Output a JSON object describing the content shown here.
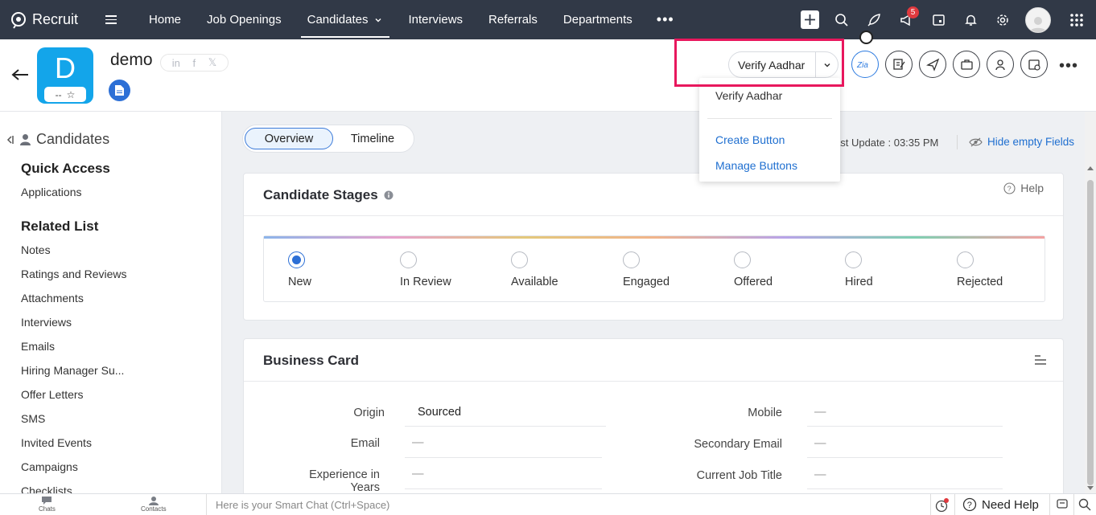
{
  "app": {
    "name": "Recruit"
  },
  "nav": {
    "items": [
      "Home",
      "Job Openings",
      "Candidates",
      "Interviews",
      "Referrals",
      "Departments"
    ],
    "active": "Candidates",
    "more": "•••",
    "notification_count": "5"
  },
  "candidate": {
    "initial": "D",
    "name": "demo",
    "rating": "--",
    "social": [
      "in",
      "f",
      "𝕏"
    ]
  },
  "actions": {
    "verify_label": "Verify Aadhar",
    "more": "•••"
  },
  "dropdown": {
    "items": [
      "Verify Aadhar",
      "Create Button",
      "Manage Buttons"
    ]
  },
  "sidebar": {
    "title": "Candidates",
    "quick_access_title": "Quick Access",
    "quick_access_items": [
      "Applications"
    ],
    "related_title": "Related List",
    "related_items": [
      "Notes",
      "Ratings and Reviews",
      "Attachments",
      "Interviews",
      "Emails",
      "Hiring Manager Su...",
      "Offer Letters",
      "SMS",
      "Invited Events",
      "Campaigns",
      "Checklists"
    ]
  },
  "tabs": {
    "overview": "Overview",
    "timeline": "Timeline"
  },
  "last_update": "ast Update : 03:35 PM",
  "hide_empty": "Hide empty Fields",
  "stages": {
    "title": "Candidate Stages",
    "help": "Help",
    "items": [
      "New",
      "In Review",
      "Available",
      "Engaged",
      "Offered",
      "Hired",
      "Rejected"
    ],
    "selected": "New"
  },
  "business_card": {
    "title": "Business Card",
    "fields": {
      "origin_label": "Origin",
      "origin_value": "Sourced",
      "email_label": "Email",
      "email_value": "—",
      "experience_label1": "Experience in",
      "experience_label2": "Years",
      "experience_value": "—",
      "mobile_label": "Mobile",
      "mobile_value": "—",
      "secondary_email_label": "Secondary Email",
      "secondary_email_value": "—",
      "job_title_label": "Current Job Title",
      "job_title_value": "—"
    }
  },
  "bottom": {
    "chats": "Chats",
    "contacts": "Contacts",
    "smart_chat_placeholder": "Here is your Smart Chat (Ctrl+Space)",
    "need_help": "Need Help"
  },
  "colors": {
    "nav_bg": "#313947",
    "accent": "#2c6fd6",
    "avatar_bg": "#13a5ea",
    "highlight": "#e8175d"
  }
}
